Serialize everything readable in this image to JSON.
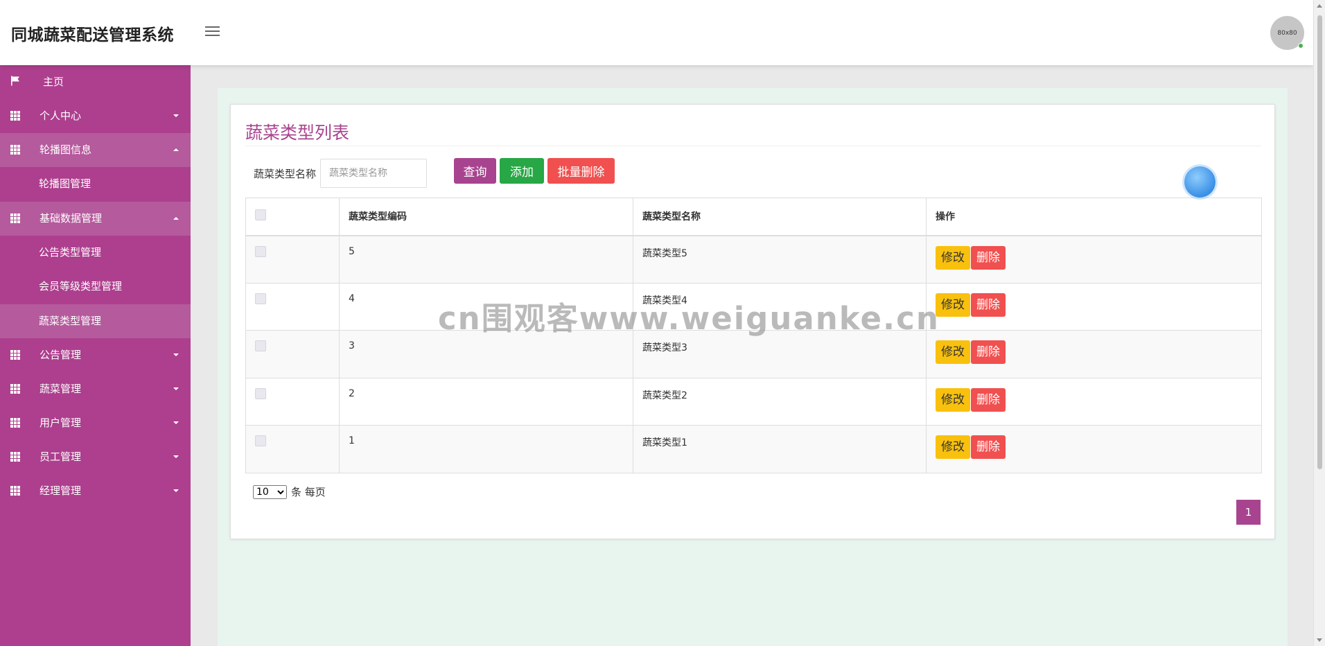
{
  "header": {
    "title": "同城蔬菜配送管理系统",
    "avatar_text": "80x80"
  },
  "sidebar": {
    "items": [
      {
        "label": "主页",
        "icon": "flag-icon"
      },
      {
        "label": "个人中心",
        "icon": "grid-icon"
      },
      {
        "label": "轮播图信息",
        "icon": "grid-icon",
        "expanded": true,
        "children": [
          {
            "label": "轮播图管理"
          }
        ]
      },
      {
        "label": "基础数据管理",
        "icon": "grid-icon",
        "expanded": true,
        "children": [
          {
            "label": "公告类型管理"
          },
          {
            "label": "会员等级类型管理"
          },
          {
            "label": "蔬菜类型管理",
            "active": true
          }
        ]
      },
      {
        "label": "公告管理",
        "icon": "grid-icon"
      },
      {
        "label": "蔬菜管理",
        "icon": "grid-icon"
      },
      {
        "label": "用户管理",
        "icon": "grid-icon"
      },
      {
        "label": "员工管理",
        "icon": "grid-icon"
      },
      {
        "label": "经理管理",
        "icon": "grid-icon"
      }
    ]
  },
  "main": {
    "title": "蔬菜类型列表",
    "search": {
      "label": "蔬菜类型名称",
      "placeholder": "蔬菜类型名称",
      "value": ""
    },
    "buttons": {
      "query": "查询",
      "add": "添加",
      "batch_delete": "批量删除"
    },
    "table": {
      "columns": [
        "蔬菜类型编码",
        "蔬菜类型名称",
        "操作"
      ],
      "rows": [
        {
          "code": "5",
          "name": "蔬菜类型5"
        },
        {
          "code": "4",
          "name": "蔬菜类型4"
        },
        {
          "code": "3",
          "name": "蔬菜类型3"
        },
        {
          "code": "2",
          "name": "蔬菜类型2"
        },
        {
          "code": "1",
          "name": "蔬菜类型1"
        }
      ],
      "edit_label": "修改",
      "delete_label": "删除"
    },
    "pagination": {
      "page_size": "10",
      "page_size_options": [
        "10"
      ],
      "per_page_text": "条 每页",
      "current_page": "1"
    }
  },
  "watermark": "cn围观客www.weiguanke.cn",
  "colors": {
    "sidebar": "#ad3f8e",
    "sidebar_active": "#b55a9d",
    "accent": "#a8448f",
    "add": "#27a745",
    "danger": "#f0504f",
    "edit": "#f9c10d",
    "content_bg": "#e8f4ee"
  }
}
